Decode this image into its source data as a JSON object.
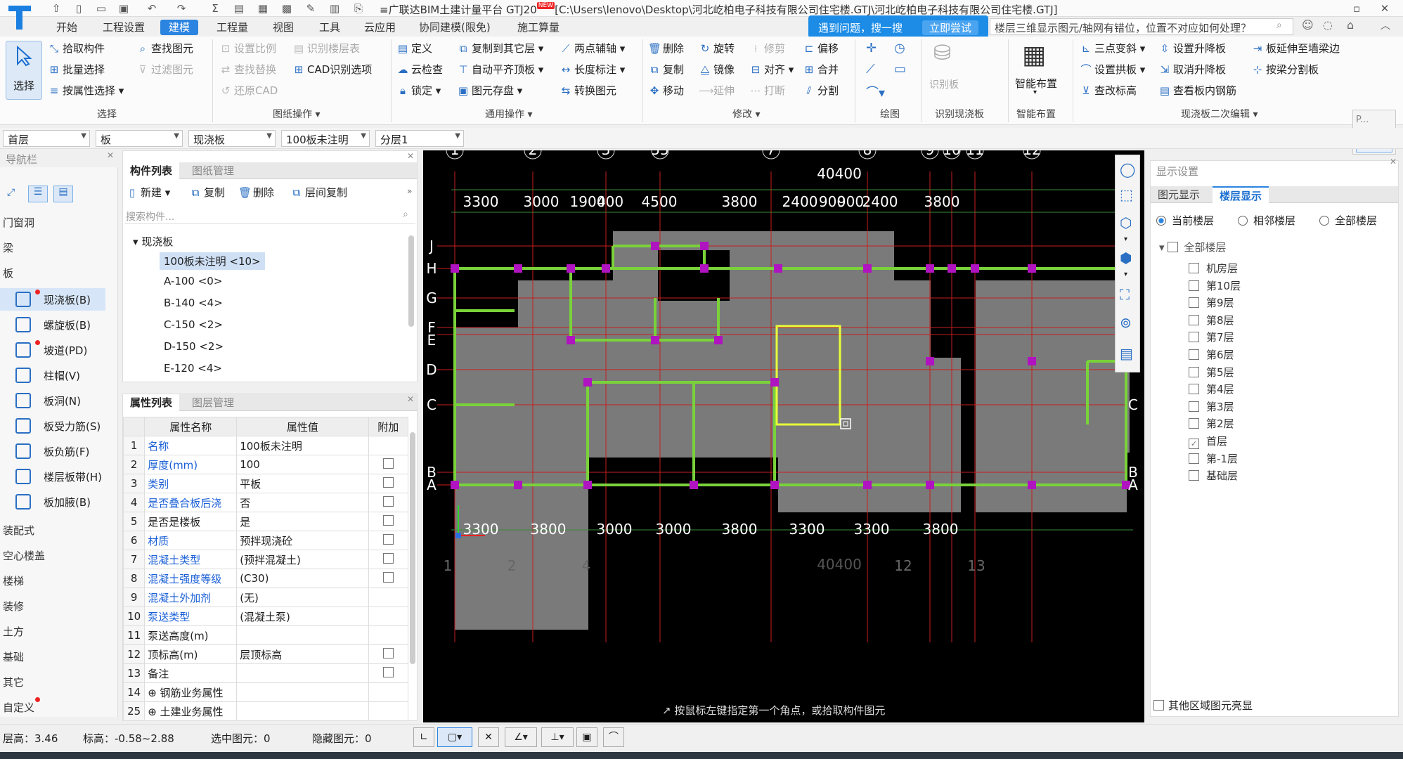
{
  "window": {
    "title_prefix": "≡广联达BIM土建计量平台 GTJ20",
    "new_badge": "NEW",
    "title_path": "[C:\\Users\\lenovo\\Desktop\\河北屹柏电子科技有限公司住宅楼.GTJ\\河北屹柏电子科技有限公司住宅楼.GTJ]"
  },
  "help_banner": {
    "text": "遇到问题，搜一搜",
    "button": "立即尝试"
  },
  "search": {
    "text": "楼层三维显示图元/轴网有错位，位置不对应如何处理？"
  },
  "menu": [
    "开始",
    "工程设置",
    "建模",
    "工程量",
    "视图",
    "工具",
    "云应用",
    "协同建模(限免)",
    "施工算量"
  ],
  "ribbon": {
    "select": "选择",
    "select_group": {
      "items": [
        "拾取构件",
        "批量选择",
        "按属性选择",
        "查找图元",
        "过滤图元"
      ],
      "label": "选择"
    },
    "drawing_group": {
      "items": [
        "设置比例",
        "识别楼层表",
        "查找替换",
        "CAD识别选项",
        "还原CAD"
      ],
      "label": "图纸操作"
    },
    "general_group": {
      "items": [
        "定义",
        "复制到其它层",
        "两点辅轴",
        "云检查",
        "自动平齐顶板",
        "长度标注",
        "锁定",
        "图元存盘",
        "转换图元"
      ],
      "label": "通用操作"
    },
    "modify_group": {
      "items": [
        "删除",
        "旋转",
        "修剪",
        "偏移",
        "复制",
        "镜像",
        "对齐",
        "合并",
        "移动",
        "延伸",
        "打断",
        "分割"
      ],
      "label": "修改"
    },
    "draw_label": "绘图",
    "recog_board": {
      "item": "识别板",
      "label": "识别现浇板"
    },
    "smart": {
      "item": "智能布置",
      "label": "智能布置"
    },
    "slab2": {
      "items": [
        "三点变斜",
        "设置升降板",
        "板延伸至墙梁边",
        "设置拱板",
        "取消升降板",
        "按梁分割板",
        "查改标高",
        "查看板内钢筋"
      ],
      "label": "现浇板二次编辑"
    },
    "start_mini": "开始",
    "p_mini": "P..."
  },
  "selectors": [
    "首层",
    "板",
    "现浇板",
    "100板未注明",
    "分层1"
  ],
  "nav": {
    "title": "导航栏",
    "categories": [
      "门窗洞",
      "梁",
      "板",
      "装配式",
      "空心楼盖",
      "楼梯",
      "装修",
      "土方",
      "基础",
      "其它",
      "自定义"
    ],
    "board_items": [
      "现浇板(B)",
      "螺旋板(B)",
      "坡道(PD)",
      "柱帽(V)",
      "板洞(N)",
      "板受力筋(S)",
      "板负筋(F)",
      "楼层板带(H)",
      "板加腋(B)"
    ]
  },
  "component_list": {
    "tabs": [
      "构件列表",
      "图纸管理"
    ],
    "toolbar": [
      "新建",
      "复制",
      "删除",
      "层间复制"
    ],
    "search_placeholder": "搜索构件...",
    "root": "现浇板",
    "items": [
      "100板未注明 <10>",
      "A-100 <0>",
      "B-140 <4>",
      "C-150 <2>",
      "D-150 <2>",
      "E-120 <4>"
    ]
  },
  "property_list": {
    "tabs": [
      "属性列表",
      "图层管理"
    ],
    "headers": [
      "属性名称",
      "属性值",
      "附加"
    ],
    "rows": [
      {
        "n": "1",
        "name": "名称",
        "value": "100板未注明",
        "blue": true,
        "cb": false
      },
      {
        "n": "2",
        "name": "厚度(mm)",
        "value": "100",
        "blue": true,
        "cb": true
      },
      {
        "n": "3",
        "name": "类别",
        "value": "平板",
        "blue": true,
        "cb": true
      },
      {
        "n": "4",
        "name": "是否叠合板后浇",
        "value": "否",
        "blue": true,
        "cb": true
      },
      {
        "n": "5",
        "name": "是否是楼板",
        "value": "是",
        "blue": false,
        "cb": true
      },
      {
        "n": "6",
        "name": "材质",
        "value": "预拌现浇砼",
        "blue": true,
        "cb": true
      },
      {
        "n": "7",
        "name": "混凝土类型",
        "value": "(预拌混凝土)",
        "blue": true,
        "cb": true
      },
      {
        "n": "8",
        "name": "混凝土强度等级",
        "value": "(C30)",
        "blue": true,
        "cb": true
      },
      {
        "n": "9",
        "name": "混凝土外加剂",
        "value": "(无)",
        "blue": true,
        "cb": false
      },
      {
        "n": "10",
        "name": "泵送类型",
        "value": "(混凝土泵)",
        "blue": true,
        "cb": false
      },
      {
        "n": "11",
        "name": "泵送高度(m)",
        "value": "",
        "blue": false,
        "cb": false
      },
      {
        "n": "12",
        "name": "顶标高(m)",
        "value": "层顶标高",
        "blue": false,
        "cb": true
      },
      {
        "n": "13",
        "name": "备注",
        "value": "",
        "blue": false,
        "cb": true
      },
      {
        "n": "14",
        "name": "⊕ 钢筋业务属性",
        "value": "",
        "blue": false,
        "cb": false
      },
      {
        "n": "25",
        "name": "⊕ 土建业务属性",
        "value": "",
        "blue": false,
        "cb": false
      }
    ]
  },
  "canvas": {
    "top_axes": [
      "1",
      "2",
      "3",
      "55",
      "7",
      "8",
      "9",
      "10",
      "11",
      "12"
    ],
    "total_dim": "40400",
    "top_dims": [
      "3300",
      "3000",
      "1900",
      "400",
      "4500",
      "3800",
      "2400",
      "900",
      "900",
      "2400",
      "3800"
    ],
    "left_axes": [
      "J",
      "H",
      "G",
      "F",
      "E",
      "D",
      "C",
      "B",
      "A"
    ],
    "right_axes": [
      "G",
      "F",
      "E",
      "C",
      "B",
      "A"
    ],
    "bottom_dims": [
      "3300",
      "3800",
      "3000",
      "3000",
      "3800",
      "3300",
      "3300",
      "3800"
    ],
    "bottom_axes": [
      "1",
      "2",
      "4",
      "12",
      "13"
    ],
    "bottom_total": "40400",
    "prompt": "按鼠标左键指定第一个角点，或拾取构件图元"
  },
  "display_settings": {
    "title": "显示设置",
    "tabs": [
      "图元显示",
      "楼层显示"
    ],
    "radios": [
      "当前楼层",
      "相邻楼层",
      "全部楼层"
    ],
    "all_floors": "全部楼层",
    "floors": [
      "机房层",
      "第10层",
      "第9层",
      "第8层",
      "第7层",
      "第6层",
      "第5层",
      "第4层",
      "第3层",
      "第2层",
      "首层",
      "第-1层",
      "基础层"
    ],
    "checked_floor": "首层",
    "other_region": "其他区域图元亮显"
  },
  "status": {
    "floor_height": "层高：3.46",
    "elevation": "标高：-0.58~2.88",
    "selected": "选中图元：0",
    "hidden": "隐藏图元：0"
  }
}
